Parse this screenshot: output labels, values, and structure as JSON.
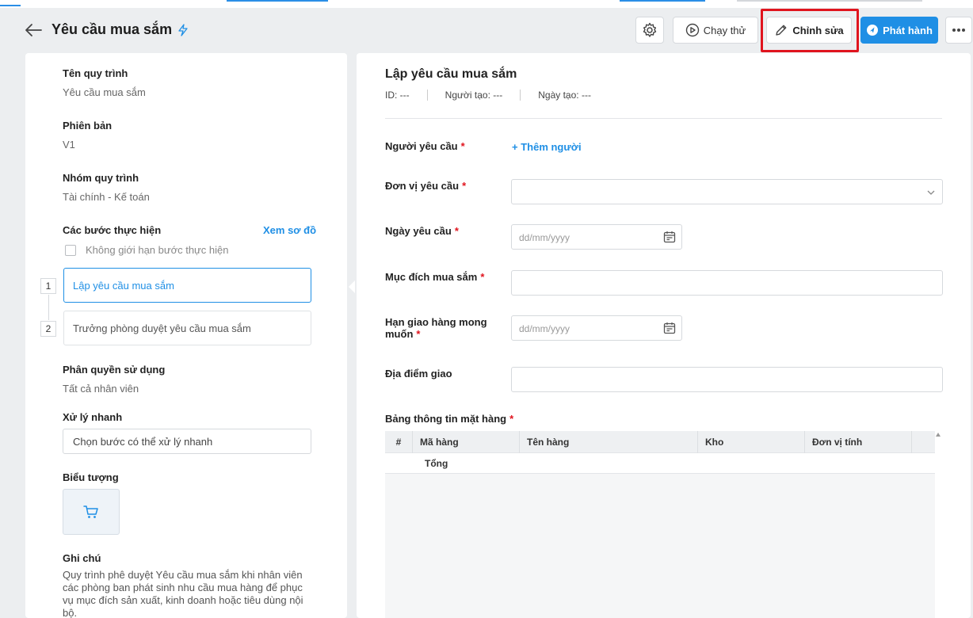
{
  "header": {
    "title": "Yêu cầu mua sắm",
    "run_label": "Chạy thử",
    "edit_label": "Chỉnh sửa",
    "publish_label": "Phát hành"
  },
  "left": {
    "process_name_label": "Tên quy trình",
    "process_name_value": "Yêu cầu mua sắm",
    "version_label": "Phiên bản",
    "version_value": "V1",
    "group_label": "Nhóm quy trình",
    "group_value": "Tài chính - Kế toán",
    "steps_label": "Các bước thực hiện",
    "view_map_label": "Xem sơ đồ",
    "no_limit_label": "Không giới hạn bước thực hiện",
    "steps": [
      {
        "num": "1",
        "label": "Lập yêu cầu mua sắm"
      },
      {
        "num": "2",
        "label": "Trưởng phòng duyệt yêu cầu mua sắm"
      }
    ],
    "permission_label": "Phân quyền sử dụng",
    "permission_value": "Tất cả nhân viên",
    "quick_label": "Xử lý nhanh",
    "quick_value": "Chọn bước có thể xử lý nhanh",
    "icon_label": "Biểu tượng",
    "note_label": "Ghi chú",
    "note_value": "Quy trình phê duyệt Yêu cầu mua sắm khi nhân viên các phòng ban phát sinh nhu cầu mua hàng để phục vụ mục đích sản xuất, kinh doanh hoặc tiêu dùng nội bộ."
  },
  "form": {
    "title": "Lập yêu cầu mua sắm",
    "id_text": "ID: ---",
    "creator_text": "Người tạo: ---",
    "created_text": "Ngày tạo: ---",
    "requester_label": "Người yêu cầu",
    "add_person_label": "+ Thêm người",
    "unit_label": "Đơn vị yêu cầu",
    "date_label": "Ngày yêu cầu",
    "date_placeholder": "dd/mm/yyyy",
    "purpose_label": "Mục đích mua sắm",
    "deadline_label_1": "Hạn giao hàng mong",
    "deadline_label_2": "muốn",
    "deadline_placeholder": "dd/mm/yyyy",
    "location_label": "Địa điểm giao",
    "table_label": "Bảng thông tin mặt hàng",
    "table_columns": [
      "#",
      "Mã hàng",
      "Tên hàng",
      "Kho",
      "Đơn vị tính"
    ],
    "total_label": "Tổng"
  },
  "colors": {
    "accent": "#1f8fe5",
    "required": "#e0141e",
    "highlight": "#e0141e"
  }
}
